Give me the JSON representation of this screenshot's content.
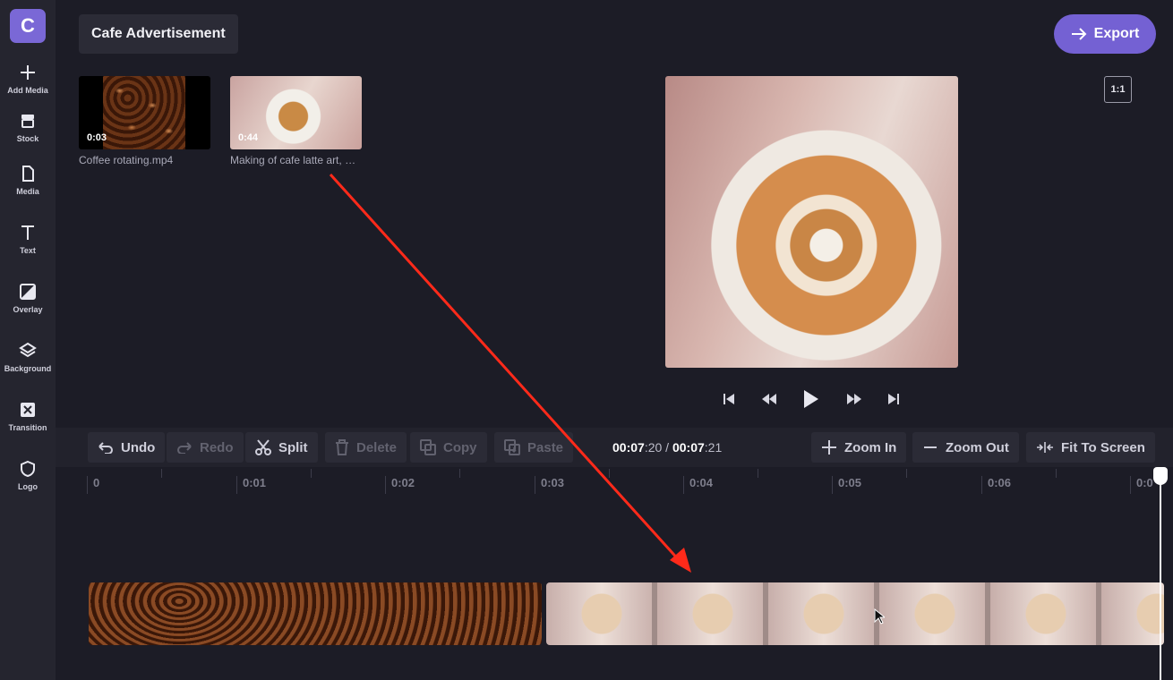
{
  "app": {
    "logo_letter": "C",
    "accent": "#7461d3"
  },
  "sidebar": {
    "items": [
      {
        "label": "Add Media",
        "icon": "plus-icon"
      },
      {
        "label": "Stock",
        "icon": "store-icon"
      },
      {
        "label": "Media",
        "icon": "file-icon"
      },
      {
        "label": "Text",
        "icon": "text-icon"
      },
      {
        "label": "Overlay",
        "icon": "overlay-icon"
      },
      {
        "label": "Background",
        "icon": "layers-icon"
      },
      {
        "label": "Transition",
        "icon": "transition-icon"
      },
      {
        "label": "Logo",
        "icon": "shield-icon"
      }
    ]
  },
  "header": {
    "project_title": "Cafe Advertisement",
    "export_label": "Export",
    "export_icon": "arrow-right-icon"
  },
  "media": [
    {
      "name": "Coffee rotating.mp4",
      "duration": "0:03"
    },
    {
      "name": "Making of cafe latte art, …",
      "duration": "0:44"
    }
  ],
  "preview": {
    "aspect_ratio_label": "1:1"
  },
  "player": {
    "controls": [
      "skip-back-icon",
      "rewind-icon",
      "play-icon",
      "fast-forward-icon",
      "skip-forward-icon"
    ]
  },
  "toolbar": {
    "undo": "Undo",
    "redo": "Redo",
    "split": "Split",
    "delete": "Delete",
    "copy": "Copy",
    "paste": "Paste",
    "zoom_in": "Zoom In",
    "zoom_out": "Zoom Out",
    "fit": "Fit To Screen",
    "time_current_main": "00:07",
    "time_current_frames": ":20",
    "time_separator": " / ",
    "time_total_main": "00:07",
    "time_total_frames": ":21"
  },
  "ruler": {
    "labels": [
      "0",
      "0:01",
      "0:02",
      "0:03",
      "0:04",
      "0:05",
      "0:06",
      "0:0"
    ]
  },
  "timeline": {
    "clips": [
      {
        "media": "Coffee rotating.mp4"
      },
      {
        "media": "Making of cafe latte art"
      }
    ]
  },
  "annotation": {
    "arrow_color": "#ff2a1a"
  }
}
